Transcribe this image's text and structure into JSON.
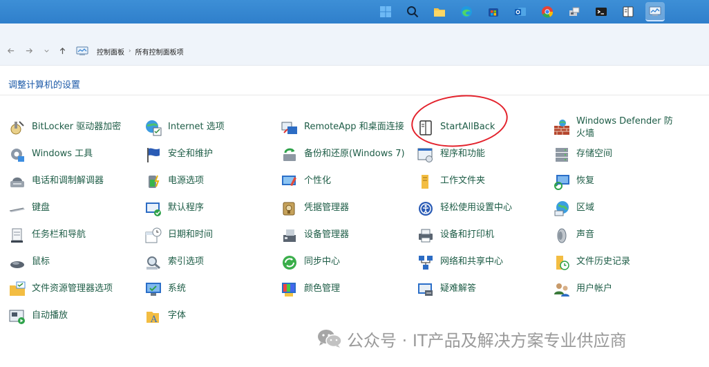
{
  "taskbar": {
    "icons": [
      "windows-start-icon",
      "search-icon",
      "file-explorer-icon",
      "edge-browser-icon",
      "store-icon",
      "outlook-icon",
      "chrome-icon",
      "app-icon",
      "terminal-icon",
      "notebook-icon",
      "control-panel-icon"
    ]
  },
  "nav": {
    "breadcrumbs": [
      "控制面板",
      "所有控制面板项"
    ],
    "separator": "›"
  },
  "header": {
    "title": "调整计算机的设置"
  },
  "columns": [
    [
      {
        "label": "BitLocker 驱动器加密",
        "icon": "bitlocker-icon"
      },
      {
        "label": "Windows 工具",
        "icon": "windows-tools-icon"
      },
      {
        "label": "电话和调制解调器",
        "icon": "phone-modem-icon"
      },
      {
        "label": "键盘",
        "icon": "keyboard-icon"
      },
      {
        "label": "任务栏和导航",
        "icon": "taskbar-icon"
      },
      {
        "label": "鼠标",
        "icon": "mouse-icon"
      },
      {
        "label": "文件资源管理器选项",
        "icon": "folder-options-icon"
      },
      {
        "label": "自动播放",
        "icon": "autoplay-icon"
      }
    ],
    [
      {
        "label": "Internet 选项",
        "icon": "internet-options-icon"
      },
      {
        "label": "安全和维护",
        "icon": "security-flag-icon"
      },
      {
        "label": "电源选项",
        "icon": "power-options-icon"
      },
      {
        "label": "默认程序",
        "icon": "default-programs-icon"
      },
      {
        "label": "日期和时间",
        "icon": "date-time-icon"
      },
      {
        "label": "索引选项",
        "icon": "indexing-icon"
      },
      {
        "label": "系统",
        "icon": "system-icon"
      },
      {
        "label": "字体",
        "icon": "fonts-icon"
      }
    ],
    [
      {
        "label": "RemoteApp 和桌面连接",
        "icon": "remoteapp-icon"
      },
      {
        "label": "备份和还原(Windows 7)",
        "icon": "backup-icon"
      },
      {
        "label": "个性化",
        "icon": "personalization-icon"
      },
      {
        "label": "凭据管理器",
        "icon": "credential-icon"
      },
      {
        "label": "设备管理器",
        "icon": "device-manager-icon"
      },
      {
        "label": "同步中心",
        "icon": "sync-icon"
      },
      {
        "label": "颜色管理",
        "icon": "color-management-icon"
      }
    ],
    [
      {
        "label": "StartAllBack",
        "icon": "startallback-icon"
      },
      {
        "label": "程序和功能",
        "icon": "programs-icon"
      },
      {
        "label": "工作文件夹",
        "icon": "work-folders-icon"
      },
      {
        "label": "轻松使用设置中心",
        "icon": "ease-of-access-icon"
      },
      {
        "label": "设备和打印机",
        "icon": "printer-icon"
      },
      {
        "label": "网络和共享中心",
        "icon": "network-icon"
      },
      {
        "label": "疑难解答",
        "icon": "troubleshoot-icon"
      }
    ],
    [
      {
        "label": "Windows Defender 防火墙",
        "icon": "firewall-icon"
      },
      {
        "label": "存储空间",
        "icon": "storage-icon"
      },
      {
        "label": "恢复",
        "icon": "recovery-icon"
      },
      {
        "label": "区域",
        "icon": "region-icon"
      },
      {
        "label": "声音",
        "icon": "sound-icon"
      },
      {
        "label": "文件历史记录",
        "icon": "file-history-icon"
      },
      {
        "label": "用户帐户",
        "icon": "user-accounts-icon"
      }
    ]
  ],
  "watermark": {
    "text": "公众号 · IT产品及解决方案专业供应商"
  }
}
